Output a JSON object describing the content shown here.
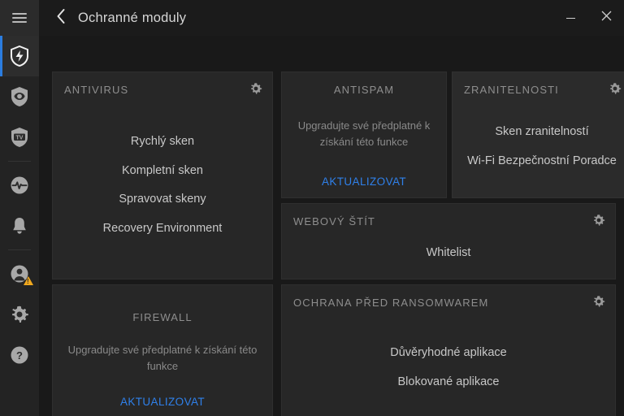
{
  "window": {
    "title": "Ochranné moduly",
    "back_icon": "chevron-left-icon",
    "minimize_label": "–",
    "close_label": "✕"
  },
  "colors": {
    "background": "#191919",
    "sidebar": "#232323",
    "card": "#272727",
    "card_lighter": "#2b2b2b",
    "accent_blue": "#2b7de0",
    "link_blue": "#2f80ea",
    "warning_amber": "#f0a81e",
    "title_text": "#d6d6d6",
    "muted_text": "#8e8e8e"
  },
  "sidebar": {
    "menu_icon": "hamburger-menu-icon",
    "items": [
      {
        "icon": "shield-protection-icon",
        "name": "protection-modules",
        "active": true
      },
      {
        "icon": "shield-eye-privacy-icon",
        "name": "privacy",
        "active": false
      },
      {
        "icon": "shield-tv-icon",
        "name": "tv-protection",
        "active": false
      },
      {
        "icon": "activity-pulse-icon",
        "name": "performance",
        "active": false
      },
      {
        "icon": "bell-notification-icon",
        "name": "notifications",
        "active": false
      },
      {
        "icon": "user-account-icon",
        "name": "account",
        "active": false,
        "badge": "warning-triangle-icon"
      },
      {
        "icon": "gear-settings-icon",
        "name": "settings",
        "active": false
      },
      {
        "icon": "question-help-icon",
        "name": "help",
        "active": false
      }
    ]
  },
  "cards": {
    "antivirus": {
      "title": "ANTIVIRUS",
      "gear_icon": "gear-icon",
      "links": [
        "Rychlý sken",
        "Kompletní sken",
        "Spravovat skeny",
        "Recovery Environment"
      ]
    },
    "antispam": {
      "title": "ANTISPAM",
      "upsell_text": "Upgradujte své předplatné k získání této funkce",
      "cta": "AKTUALIZOVAT"
    },
    "vulnerabilities": {
      "title": "ZRANITELNOSTI",
      "gear_icon": "gear-icon",
      "links": [
        "Sken zranitelností",
        "Wi-Fi Bezpečnostní Poradce"
      ]
    },
    "web_shield": {
      "title": "WEBOVÝ ŠTÍT",
      "gear_icon": "gear-icon",
      "links": [
        "Whitelist"
      ]
    },
    "firewall": {
      "title": "FIREWALL",
      "upsell_text": "Upgradujte své předplatné k získání této funkce",
      "cta": "AKTUALIZOVAT"
    },
    "ransomware": {
      "title": "OCHRANA PŘED RANSOMWAREM",
      "gear_icon": "gear-icon",
      "links": [
        "Důvěryhodné aplikace",
        "Blokované aplikace"
      ]
    }
  }
}
